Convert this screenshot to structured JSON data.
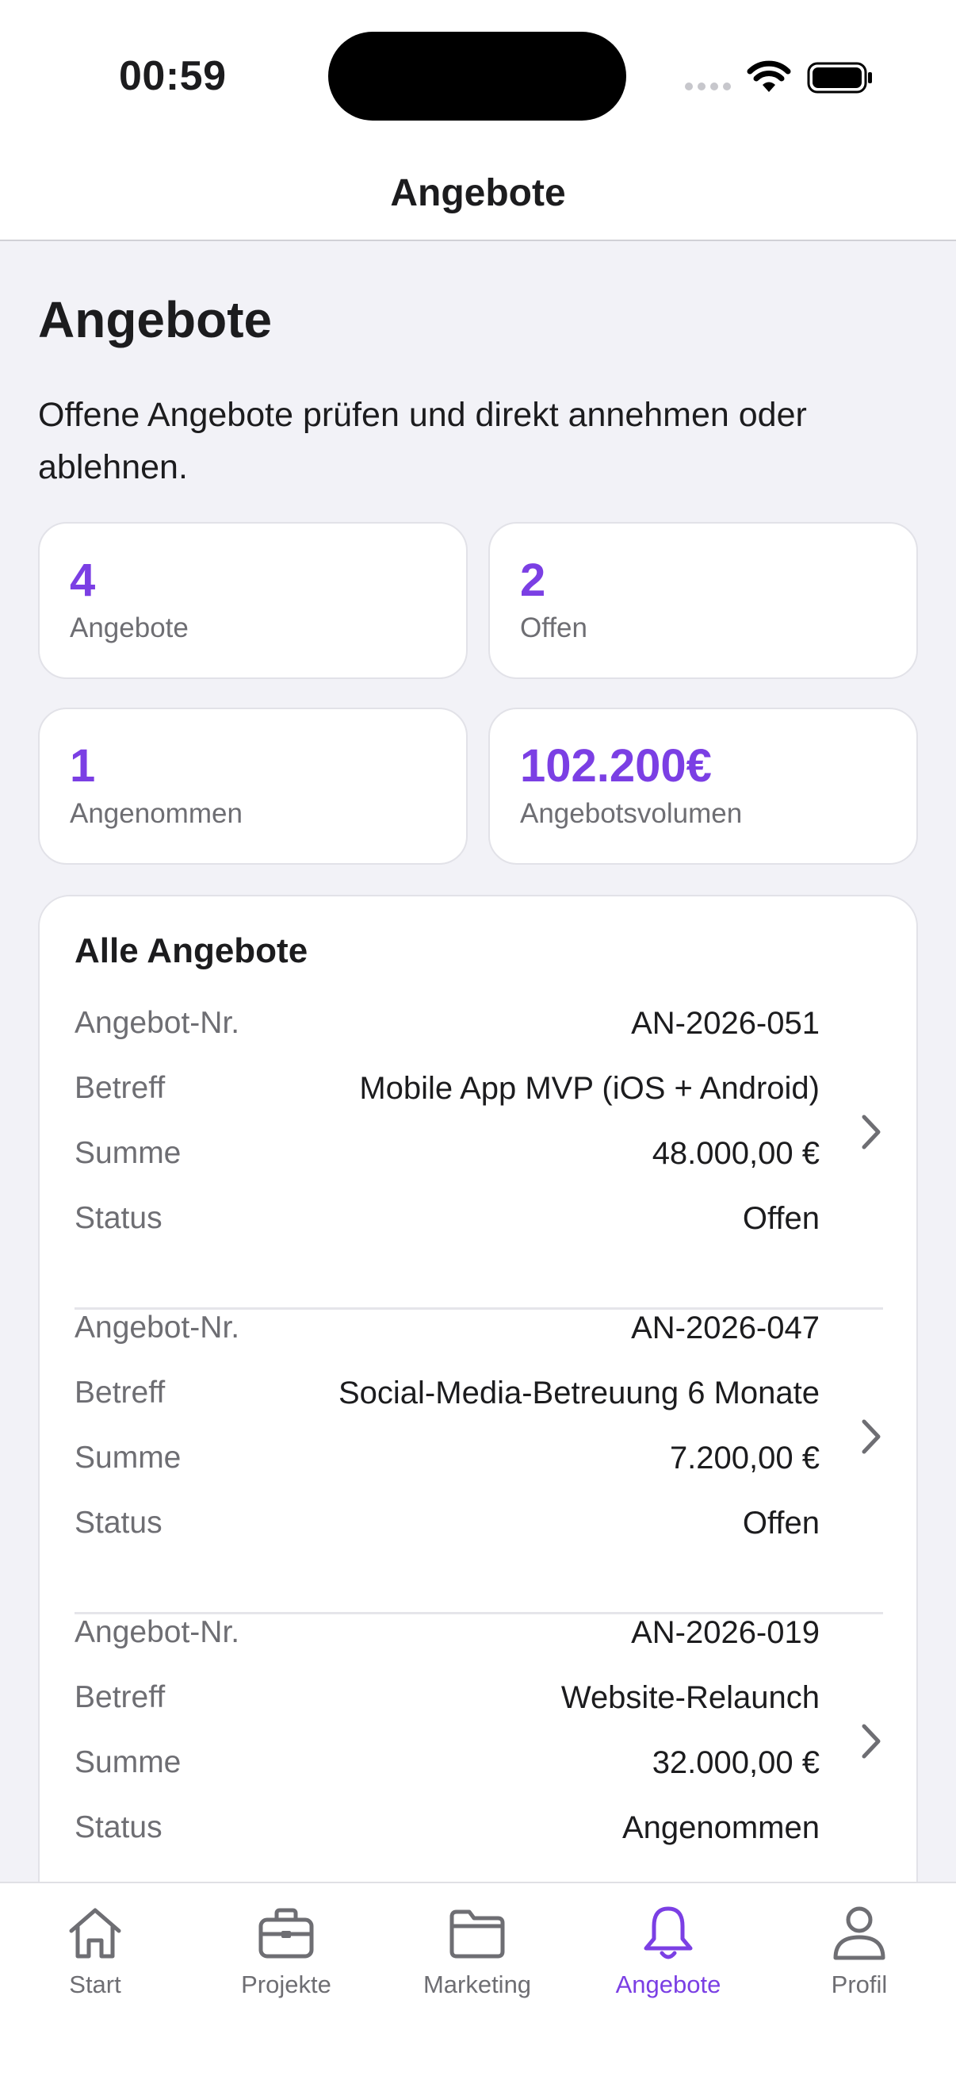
{
  "status_bar": {
    "time": "00:59"
  },
  "nav": {
    "title": "Angebote"
  },
  "page": {
    "title": "Angebote",
    "description": "Offene Angebote prüfen und direkt annehmen oder ablehnen."
  },
  "stats": [
    {
      "value": "4",
      "label": "Angebote"
    },
    {
      "value": "2",
      "label": "Offen"
    },
    {
      "value": "1",
      "label": "Angenommen"
    },
    {
      "value": "102.200€",
      "label": "Angebotsvolumen"
    }
  ],
  "list": {
    "title": "Alle Angebote",
    "labels": {
      "number": "Angebot-Nr.",
      "subject": "Betreff",
      "sum": "Summe",
      "status": "Status"
    },
    "offers": [
      {
        "number": "AN-2026-051",
        "subject": "Mobile App MVP (iOS + Android)",
        "sum": "48.000,00 €",
        "status": "Offen"
      },
      {
        "number": "AN-2026-047",
        "subject": "Social-Media-Betreuung 6 Monate",
        "sum": "7.200,00 €",
        "status": "Offen"
      },
      {
        "number": "AN-2026-019",
        "subject": "Website-Relaunch",
        "sum": "32.000,00 €",
        "status": "Angenommen"
      }
    ]
  },
  "tabs": [
    {
      "label": "Start",
      "icon": "house-icon",
      "active": false
    },
    {
      "label": "Projekte",
      "icon": "briefcase-icon",
      "active": false
    },
    {
      "label": "Marketing",
      "icon": "folder-icon",
      "active": false
    },
    {
      "label": "Angebote",
      "icon": "bell-icon",
      "active": true
    },
    {
      "label": "Profil",
      "icon": "person-icon",
      "active": false
    }
  ],
  "colors": {
    "accent": "#7b3fe4",
    "inactive": "#6e6e73",
    "background": "#f2f2f7"
  }
}
